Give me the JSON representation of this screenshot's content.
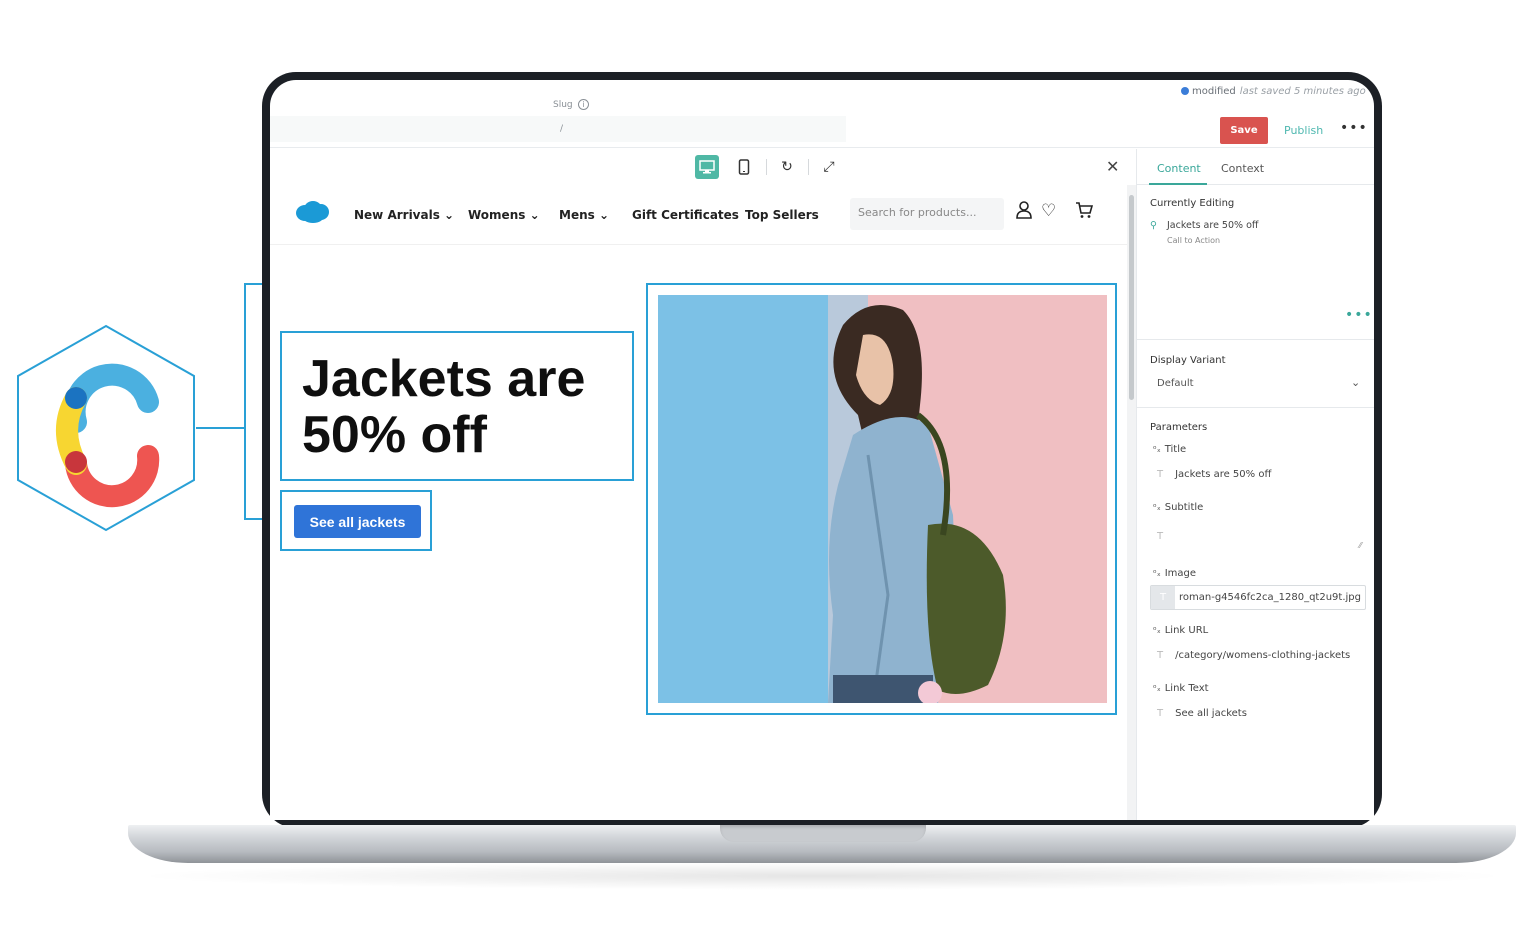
{
  "editor": {
    "slug_label": "Slug",
    "slug_info_icon": "info-icon",
    "slug_value": "/",
    "status_text": "modified",
    "status_saved": "last saved 5 minutes ago",
    "save_label": "Save",
    "publish_label": "Publish",
    "more_icon": "more-horizontal-icon",
    "status_color": "#3b7dd8",
    "save_color": "#d9534f",
    "accent_color": "#4fb8a5"
  },
  "preview_toolbar": {
    "icons": [
      "desktop-icon",
      "mobile-icon",
      "refresh-icon",
      "expand-icon",
      "close-icon"
    ]
  },
  "site": {
    "logo": "salesforce-cloud-logo",
    "nav": [
      "New Arrivals",
      "Womens",
      "Mens",
      "Gift Certificates",
      "Top Sellers"
    ],
    "search_placeholder": "Search for products...",
    "header_icons": [
      "account-icon",
      "heart-icon",
      "cart-icon"
    ]
  },
  "canvas": {
    "heading_line1": "Jackets are",
    "heading_line2": "50% off",
    "cta_label": "See all jackets",
    "cta_color": "#2f74d8",
    "highlight_color": "#29a0d6"
  },
  "panel": {
    "tabs": [
      "Content",
      "Context"
    ],
    "currently_editing_title": "Currently Editing",
    "currently_editing_item": "Jackets are 50% off",
    "currently_editing_type": "Call to Action",
    "display_variant_title": "Display Variant",
    "display_variant_value": "Default",
    "parameters_title": "Parameters",
    "params": {
      "title_label": "Title",
      "title_value": "Jackets are 50% off",
      "subtitle_label": "Subtitle",
      "subtitle_value": "",
      "image_label": "Image",
      "image_value": "roman-g4546fc2ca_1280_qt2u9t.jpg",
      "link_url_label": "Link URL",
      "link_url_value": "/category/womens-clothing-jackets",
      "link_text_label": "Link Text",
      "link_text_value": "See all jackets"
    },
    "text_type_marker": "T"
  }
}
